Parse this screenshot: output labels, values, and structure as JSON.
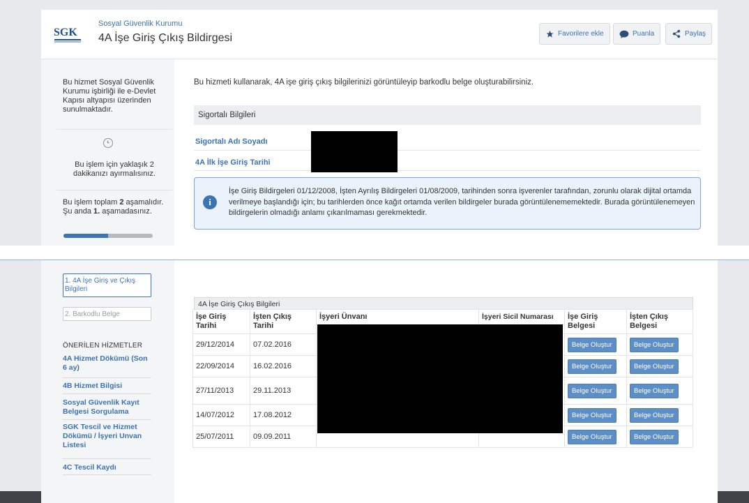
{
  "header": {
    "logo_text": "SGK",
    "organization": "Sosyal Güvenlik Kurumu",
    "title": "4A İşe Giriş Çıkış Bildirgesi",
    "actions": [
      {
        "label": "Favorilere ekle",
        "icon": "star-icon"
      },
      {
        "label": "Puanla",
        "icon": "speech-bubble-icon"
      },
      {
        "label": "Paylaş",
        "icon": "share-icon"
      }
    ]
  },
  "sidebar": {
    "service_note": "Bu hizmet Sosyal Güvenlik Kurumu işbirliği ile e-Devlet Kapısı altyapısı üzerinden sunulmaktadır.",
    "duration_note": "Bu işlem için yaklaşık 2 dakikanızı ayırmalısınız.",
    "stage_note_prefix": "Bu işlem toplam ",
    "stage_total": "2",
    "stage_note_middle": " aşamalıdır. Şu anda ",
    "stage_current": "1.",
    "stage_note_suffix": " aşamadasınız.",
    "progress_fraction": 0.5,
    "steps": [
      {
        "label": "1. 4A İşe Giriş ve Çıkış Bilgileri",
        "active": true
      },
      {
        "label": "2. Barkodlu Belge",
        "active": false
      }
    ],
    "recommended_title": "ÖNERİLEN HİZMETLER",
    "recommended": [
      "4A Hizmet Dökümü (Son 6 ay)",
      "4B Hizmet Bilgisi",
      "Sosyal Güvenlik Kayıt Belgesi Sorgulama",
      "SGK Tescil ve Hizmet Dökümü / İşyeri Unvan Listesi",
      "4C Tescil Kaydı"
    ]
  },
  "main": {
    "intro": "Bu hizmeti kullanarak, 4A işe giriş çıkış bilgilerinizi görüntüleyip barkodlu belge oluşturabilirsiniz.",
    "section_title": "Sigortalı Bilgileri",
    "fields": [
      {
        "label": "Sigortalı Adı Soyadı"
      },
      {
        "label": "4A İlk İşe Giriş Tarihi"
      }
    ],
    "info_icon_glyph": "i",
    "info_text": "İşe Giriş Bildirgeleri 01/12/2008, İşten Ayrılış Bildirgeleri 01/08/2009, tarihinden sonra işverenler tarafından, zorunlu olarak dijital ortamda verilmeye başlandığı için; bu tarihlerden önce kağıt ortamda verilen bildirgeler burada görüntülenememektedir. Burada görüntülenemeyen bildirgelerin olmadığı anlamı çıkarılmaması gerekmektedir."
  },
  "table": {
    "title": "4A İşe Giriş Çıkış Bilgileri",
    "columns": [
      "İşe Giriş Tarihi",
      "İşten Çıkış Tarihi",
      "İşyeri Ünvanı",
      "İşyeri Sicil Numarası",
      "İşe Giriş Belgesi",
      "İşten Çıkış Belgesi"
    ],
    "button_label": "Belge Oluştur",
    "rows": [
      {
        "giris": "29/12/2014",
        "cikis": "07.02.2016"
      },
      {
        "giris": "22/09/2014",
        "cikis": "16.02.2016"
      },
      {
        "giris": "27/11/2013",
        "cikis": "29.11.2013"
      },
      {
        "giris": "14/07/2012",
        "cikis": "17.08.2012"
      },
      {
        "giris": "25/07/2011",
        "cikis": "09.09.2011"
      }
    ]
  },
  "colors": {
    "accent": "#3b73b3",
    "button": "#5d8ec6",
    "footer": "#3f4246"
  }
}
